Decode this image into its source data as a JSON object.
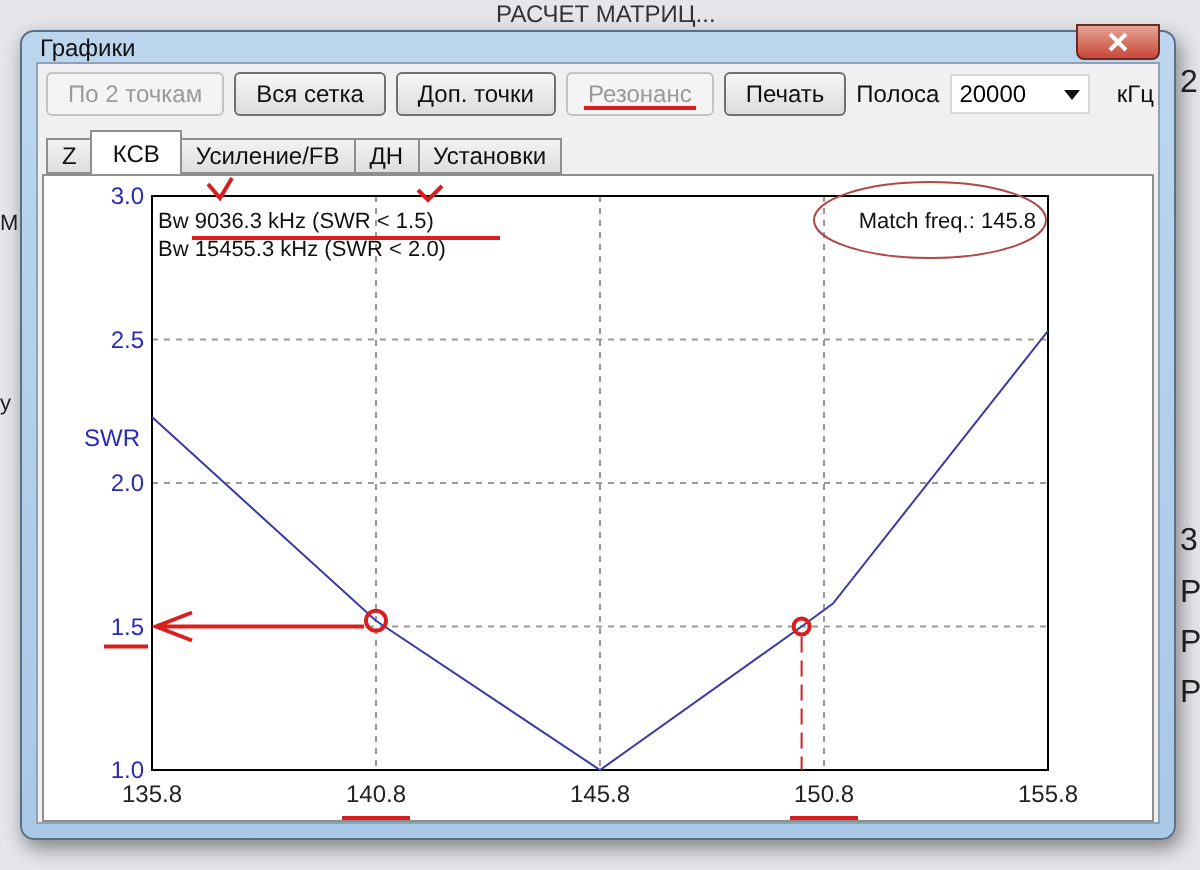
{
  "background_app": {
    "heading": "РАСЧЕТ МАТРИЦ...",
    "left_fragments": [
      "М",
      "у"
    ],
    "right_fragments": [
      "2",
      "3",
      "Р",
      "Р",
      "Р"
    ]
  },
  "window": {
    "title": "Графики"
  },
  "buttons": [
    {
      "label": "По 2 точкам",
      "disabled": true
    },
    {
      "label": "Вся сетка",
      "disabled": false
    },
    {
      "label": "Доп. точки",
      "disabled": false
    },
    {
      "label": "Резонанс",
      "disabled": true,
      "underlined": true
    },
    {
      "label": "Печать",
      "disabled": false
    }
  ],
  "band": {
    "label": "Полоса",
    "value": "20000",
    "unit": "кГц"
  },
  "tabs": [
    {
      "label": "Z",
      "selected": false
    },
    {
      "label": "КСВ",
      "selected": true
    },
    {
      "label": "Усиление/FB",
      "selected": false
    },
    {
      "label": "ДН",
      "selected": false
    },
    {
      "label": "Установки",
      "selected": false
    }
  ],
  "chart": {
    "bandwidth_lines": [
      "Bw 9036.3 kHz (SWR < 1.5)",
      "Bw 15455.3 kHz (SWR < 2.0)"
    ],
    "match_label": "Match freq.: 145.8",
    "chart_data": {
      "type": "line",
      "grid": true,
      "xlim": [
        135.8,
        155.8
      ],
      "ylim": [
        1.0,
        3.0
      ],
      "xticks": [
        {
          "value": 135.8,
          "label": "135.8"
        },
        {
          "value": 140.8,
          "label": "140.8"
        },
        {
          "value": 145.8,
          "label": "145.8"
        },
        {
          "value": 150.8,
          "label": "150.8"
        },
        {
          "value": 155.8,
          "label": "155.8"
        }
      ],
      "yticks": [
        {
          "value": 1.0,
          "label": "1.0"
        },
        {
          "value": 1.5,
          "label": "1.5"
        },
        {
          "value": 2.0,
          "label": "2.0"
        },
        {
          "value": 2.5,
          "label": "2.5"
        },
        {
          "value": 3.0,
          "label": "3.0"
        }
      ],
      "x": [
        135.8,
        140.8,
        145.8,
        150.3,
        151.0,
        155.8
      ],
      "series": [
        {
          "name": "SWR",
          "color": "#3a3aa8",
          "values": [
            2.23,
            1.52,
            1.0,
            1.5,
            1.58,
            2.53
          ]
        }
      ]
    }
  }
}
